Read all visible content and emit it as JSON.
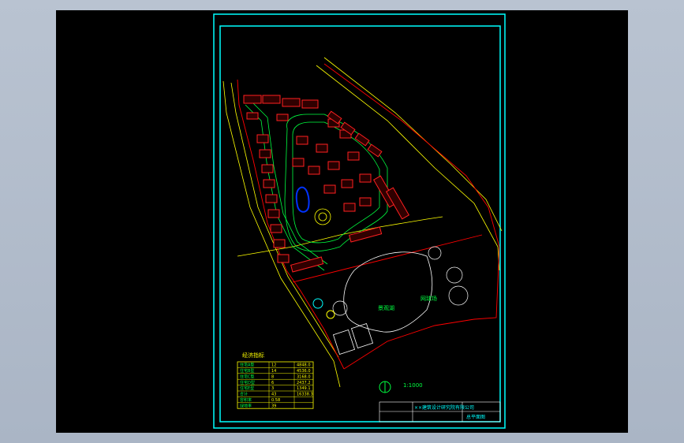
{
  "canvas": {
    "background": "#000000",
    "frame_color": "#00ffff",
    "surround_color": "#b4bfcd"
  },
  "colors": {
    "road": "#ffff00",
    "boundary": "#ff0000",
    "buildings": "#ff2020",
    "green": "#00ff40",
    "label": "#00ff40",
    "table": "#ffff00",
    "water": "#0033ff",
    "title_text": "#00ffff"
  },
  "site_plan": {
    "lake_label": "景观湖",
    "court_label": "网球场",
    "scale_label": "1:1000",
    "north_symbol": "north-arrow-icon"
  },
  "legend": {
    "title": "经济指标",
    "rows": [
      [
        "住宅A型",
        "12",
        "4848.0"
      ],
      [
        "住宅B型",
        "14",
        "4536.0"
      ],
      [
        "住宅C型",
        "8",
        "3168.0"
      ],
      [
        "住宅D型",
        "6",
        "2437.2"
      ],
      [
        "住宅E型",
        "3",
        "1349.1"
      ],
      [
        "合计",
        "43",
        "16338.3"
      ],
      [
        "容积率",
        "0.58",
        ""
      ],
      [
        "绿地率",
        "39",
        ""
      ]
    ]
  },
  "title_block": {
    "company": "××建筑设计研究院有限公司",
    "drawing_name": "总平面图"
  }
}
